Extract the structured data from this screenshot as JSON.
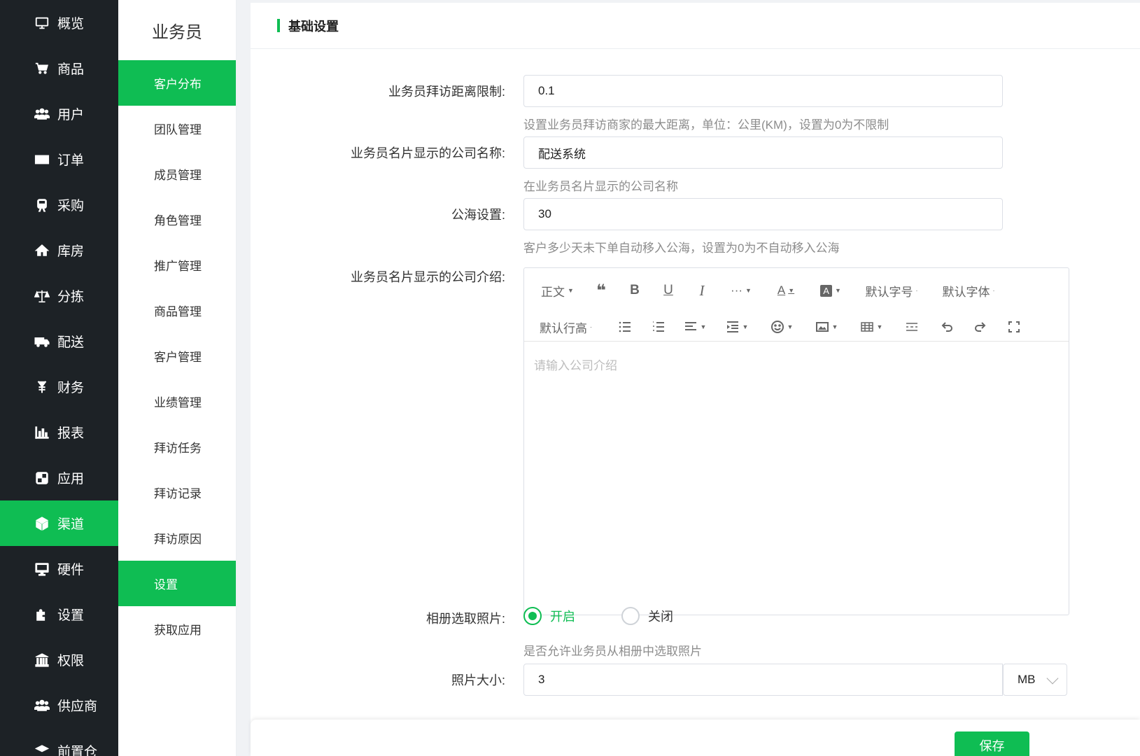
{
  "nav": {
    "items": [
      {
        "label": "概览",
        "icon": "monitor-icon"
      },
      {
        "label": "商品",
        "icon": "cart-icon"
      },
      {
        "label": "用户",
        "icon": "users-icon"
      },
      {
        "label": "订单",
        "icon": "money-icon"
      },
      {
        "label": "采购",
        "icon": "train-icon"
      },
      {
        "label": "库房",
        "icon": "home-icon"
      },
      {
        "label": "分拣",
        "icon": "scale-icon"
      },
      {
        "label": "配送",
        "icon": "truck-icon"
      },
      {
        "label": "财务",
        "icon": "yen-icon"
      },
      {
        "label": "报表",
        "icon": "bar-chart-icon"
      },
      {
        "label": "应用",
        "icon": "apps-icon"
      },
      {
        "label": "渠道",
        "icon": "cube-icon"
      },
      {
        "label": "硬件",
        "icon": "desktop-icon"
      },
      {
        "label": "设置",
        "icon": "puzzle-icon"
      },
      {
        "label": "权限",
        "icon": "bank-icon"
      },
      {
        "label": "供应商",
        "icon": "users-icon"
      },
      {
        "label": "前置仓",
        "icon": "box-icon"
      }
    ],
    "active_index": 11
  },
  "subnav": {
    "title": "业务员",
    "items": [
      "客户分布",
      "团队管理",
      "成员管理",
      "角色管理",
      "推广管理",
      "商品管理",
      "客户管理",
      "业绩管理",
      "拜访任务",
      "拜访记录",
      "拜访原因",
      "设置",
      "获取应用"
    ],
    "active_indices": [
      0,
      11
    ]
  },
  "panel": {
    "title": "基础设置"
  },
  "form": {
    "visit_distance": {
      "label": "业务员拜访距离限制:",
      "value": "0.1",
      "hint": "设置业务员拜访商家的最大距离，单位：公里(KM)，设置为0为不限制"
    },
    "company_name": {
      "label": "业务员名片显示的公司名称:",
      "value": "配送系统",
      "hint": "在业务员名片显示的公司名称"
    },
    "public_sea": {
      "label": "公海设置:",
      "value": "30",
      "hint": "客户多少天未下单自动移入公海，设置为0为不自动移入公海"
    },
    "company_intro": {
      "label": "业务员名片显示的公司介绍:",
      "placeholder": "请输入公司介绍",
      "toolbar": {
        "paragraph": "正文",
        "font_size": "默认字号",
        "font_family": "默认字体",
        "line_height": "默认行高"
      }
    },
    "album_photo": {
      "label": "相册选取照片:",
      "options": [
        "开启",
        "关闭"
      ],
      "selected": "开启",
      "hint": "是否允许业务员从相册中选取照片"
    },
    "photo_size": {
      "label": "照片大小:",
      "value": "3",
      "unit": "MB"
    }
  },
  "footer": {
    "save_label": "保存"
  },
  "colors": {
    "accent": "#0fbd53",
    "nav_bg": "#1d2226"
  }
}
